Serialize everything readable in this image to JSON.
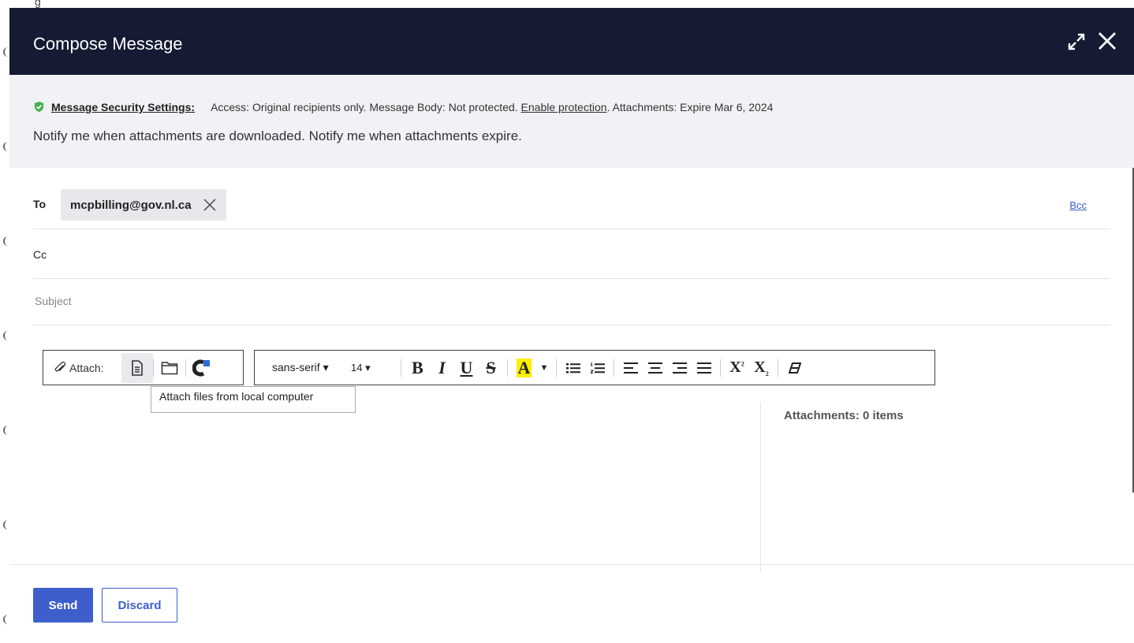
{
  "backdrop": {
    "partial_text": "g"
  },
  "header": {
    "title": "Compose Message",
    "icons": {
      "expand": "expand-icon",
      "close": "close-icon"
    }
  },
  "security": {
    "label": "Message Security Settings:",
    "access_text": "Access: Original recipients only. Message Body: Not protected. ",
    "enable_link": "Enable protection",
    "attachments_text": ". Attachments: Expire Mar 6, 2024",
    "notify_text": "Notify me when attachments are downloaded. Notify me when attachments expire.",
    "icon": "shield-check-icon",
    "icon_color": "#4caf50"
  },
  "recipients": {
    "to_label": "To",
    "to_chip": "mcpbilling@gov.nl.ca",
    "cc_label": "Cc",
    "bcc_link": "Bcc"
  },
  "subject": {
    "placeholder": "Subject",
    "value": ""
  },
  "attach_toolbar": {
    "label": "Attach:",
    "tooltip": "Attach files from local computer",
    "icons": [
      "paperclip-icon",
      "file-icon",
      "folder-icon",
      "cloud-provider-icon"
    ]
  },
  "format_toolbar": {
    "font": "sans-serif",
    "size": "14",
    "highlight_color": "#ffee00"
  },
  "attachments": {
    "title": "Attachments: 0 items"
  },
  "footer": {
    "send_label": "Send",
    "discard_label": "Discard"
  },
  "colors": {
    "header_bg": "#141b33",
    "accent": "#3e5fcb",
    "security_bg": "#f1f2f5"
  }
}
